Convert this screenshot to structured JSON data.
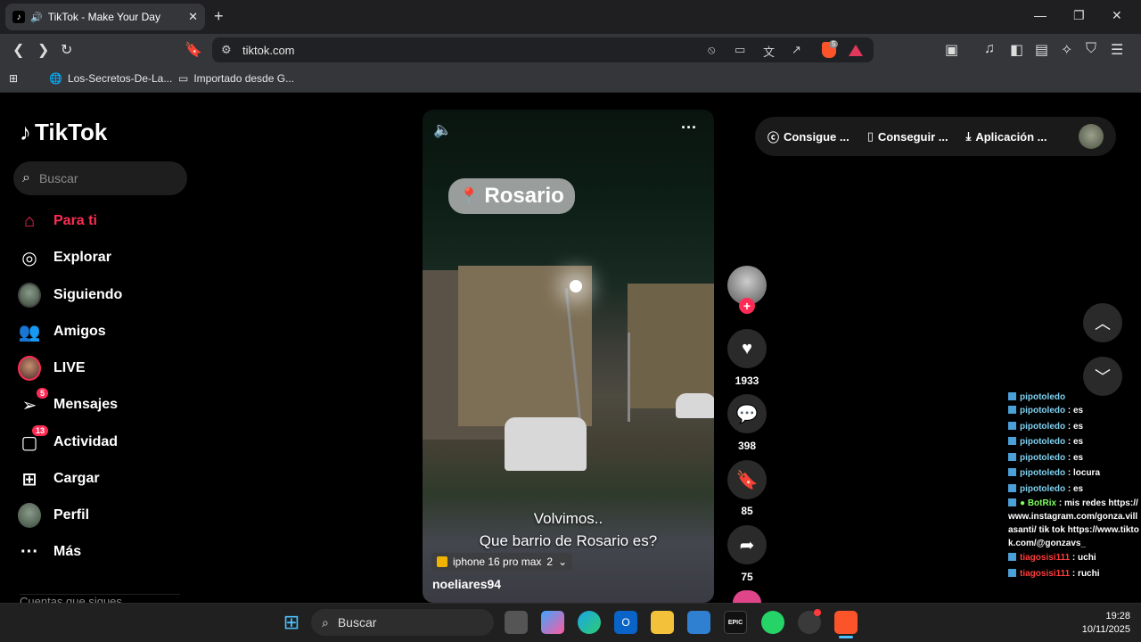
{
  "browser": {
    "tab_title": "TikTok - Make Your Day",
    "url": "tiktok.com",
    "bookmarks": [
      "Los-Secretos-De-La...",
      "Importado desde G..."
    ],
    "brave_badge": "5"
  },
  "sidebar": {
    "logo": "TikTok",
    "search_placeholder": "Buscar",
    "items": [
      {
        "label": "Para ti",
        "icon": "home-icon",
        "active": true
      },
      {
        "label": "Explorar",
        "icon": "compass-icon"
      },
      {
        "label": "Siguiendo",
        "icon": "following-avatar-icon"
      },
      {
        "label": "Amigos",
        "icon": "friends-icon"
      },
      {
        "label": "LIVE",
        "icon": "live-avatar-icon"
      },
      {
        "label": "Mensajes",
        "icon": "send-icon",
        "badge": "5"
      },
      {
        "label": "Actividad",
        "icon": "activity-icon",
        "badge": "13"
      },
      {
        "label": "Cargar",
        "icon": "upload-icon"
      },
      {
        "label": "Perfil",
        "icon": "profile-avatar-icon"
      },
      {
        "label": "Más",
        "icon": "more-icon"
      }
    ],
    "footer_partial": "Cuentas que sigues"
  },
  "video": {
    "place": "Rosario",
    "caption_line1": "Volvimos..",
    "caption_line2": "Que barrio de Rosario es?",
    "anchor_text": "iphone 16 pro max",
    "anchor_count": "2",
    "author": "noeliares94"
  },
  "actions": {
    "likes": "1933",
    "comments": "398",
    "saves": "85",
    "shares": "75"
  },
  "top_pill": {
    "coins": "Consigue ...",
    "get_app": "Conseguir ...",
    "download": "Aplicación ..."
  },
  "chat": [
    {
      "user": "pipotoledo",
      "msg": "es",
      "color": "blue"
    },
    {
      "user": "pipotoledo",
      "msg": "es",
      "color": "blue"
    },
    {
      "user": "pipotoledo",
      "msg": "es",
      "color": "blue"
    },
    {
      "user": "pipotoledo",
      "msg": "es",
      "color": "blue"
    },
    {
      "user": "pipotoledo",
      "msg": "es",
      "color": "blue"
    },
    {
      "user": "pipotoledo",
      "msg": "locura",
      "color": "blue"
    }
  ],
  "chat_botrix": {
    "user": "BotRix",
    "msg": "mis redes https://www.instagram.com/gonza.villasanti/ tik tok https://www.tiktok.com/@gonzavs_"
  },
  "chat_tail": [
    {
      "user": "tiagosisi111",
      "msg": "uchi",
      "color": "red"
    },
    {
      "user": "tiagosisi111",
      "msg": "ruchi",
      "color": "red"
    }
  ],
  "taskbar": {
    "search_placeholder": "Buscar",
    "time": "19:28",
    "date": "10/11/2025"
  },
  "colors": {
    "accent": "#fe2c55",
    "chrome_dark": "#35363a",
    "background": "#000000"
  }
}
